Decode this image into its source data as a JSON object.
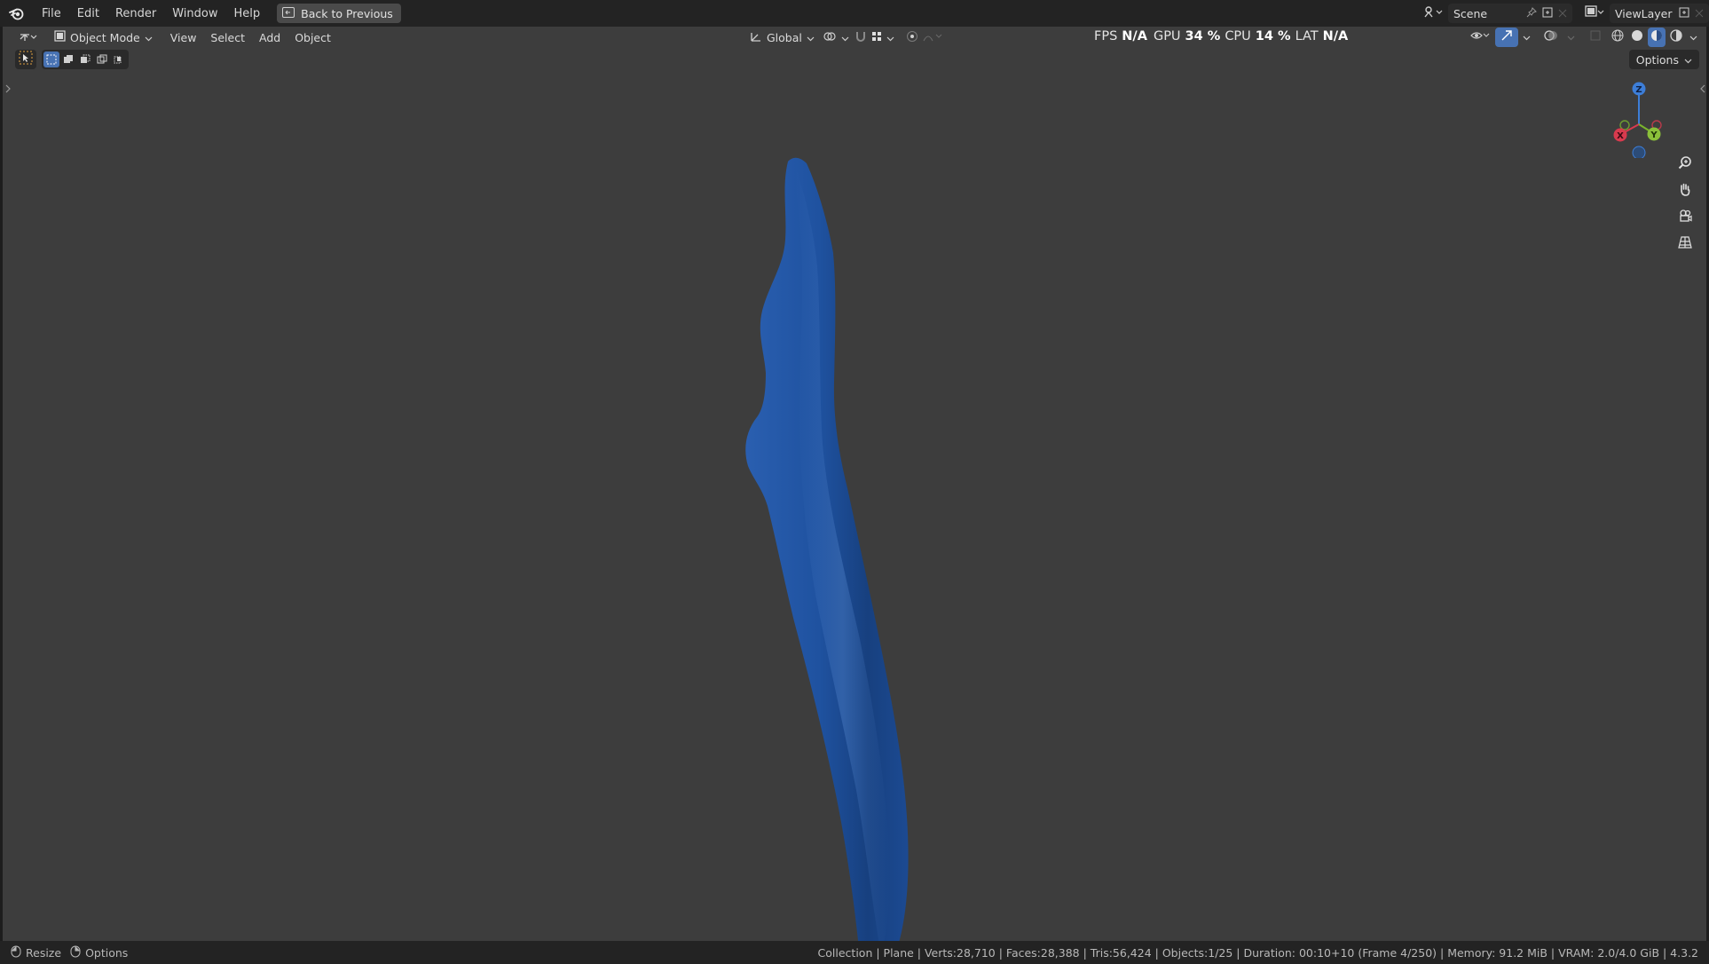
{
  "topbar": {
    "menus": [
      "File",
      "Edit",
      "Render",
      "Window",
      "Help"
    ],
    "back_label": "Back to Previous",
    "scene_name": "Scene",
    "view_layer": "ViewLayer"
  },
  "viewport": {
    "mode_label": "Object Mode",
    "menus": [
      "View",
      "Select",
      "Add",
      "Object"
    ],
    "orientation": "Global",
    "options_label": "Options",
    "stats": {
      "fps_label": "FPS",
      "fps_value": "N/A",
      "gpu_label": "GPU",
      "gpu_value": "34 %",
      "cpu_label": "CPU",
      "cpu_value": "14 %",
      "lat_label": "LAT",
      "lat_value": "N/A"
    },
    "gizmo": {
      "x": "X",
      "y": "Y",
      "z": "Z"
    },
    "object_color": "#1f4f9a",
    "background_color": "#3d3d3d"
  },
  "statusbar": {
    "resize_label": "Resize",
    "options_label": "Options",
    "info": "Collection | Plane | Verts:28,710 | Faces:28,388 | Tris:56,424 | Objects:1/25 | Duration: 00:10+10 (Frame 4/250) | Memory: 91.2 MiB | VRAM: 2.0/4.0 GiB | 4.3.2"
  },
  "icons": {
    "logo": "blender-logo-icon",
    "back": "back-to-previous-icon",
    "scene": "scene-icon",
    "view_layer": "view-layer-icon"
  }
}
